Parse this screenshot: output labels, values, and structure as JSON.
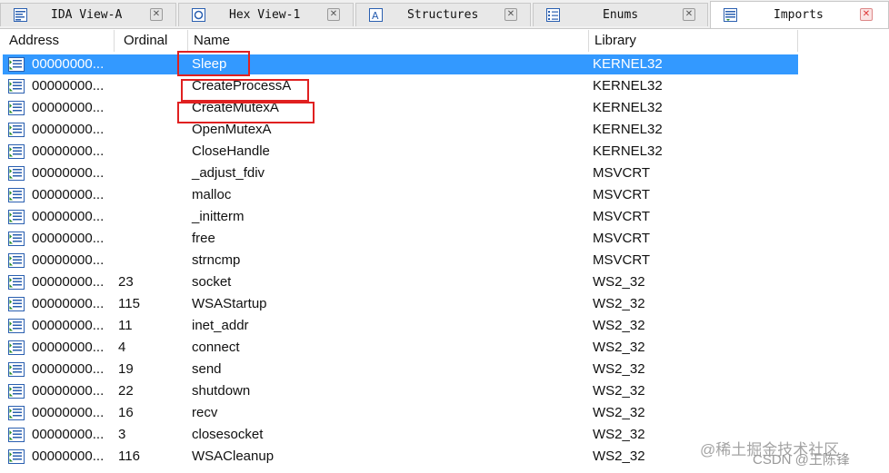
{
  "tabs": [
    {
      "label": "IDA View-A",
      "icon": "ida-view-icon"
    },
    {
      "label": "Hex View-1",
      "icon": "hex-view-icon"
    },
    {
      "label": "Structures",
      "icon": "structures-icon"
    },
    {
      "label": "Enums",
      "icon": "enums-icon"
    },
    {
      "label": "Imports",
      "icon": "imports-icon",
      "active": true
    }
  ],
  "close_glyph": "✕",
  "columns": [
    "Address",
    "Ordinal",
    "Name",
    "Library"
  ],
  "rows": [
    {
      "address": "00000000...",
      "ordinal": "",
      "name": "Sleep",
      "library": "KERNEL32",
      "selected": true,
      "highlighted": true
    },
    {
      "address": "00000000...",
      "ordinal": "",
      "name": "CreateProcessA",
      "library": "KERNEL32",
      "highlighted": true
    },
    {
      "address": "00000000...",
      "ordinal": "",
      "name": "CreateMutexA",
      "library": "KERNEL32",
      "highlighted": true
    },
    {
      "address": "00000000...",
      "ordinal": "",
      "name": "OpenMutexA",
      "library": "KERNEL32"
    },
    {
      "address": "00000000...",
      "ordinal": "",
      "name": "CloseHandle",
      "library": "KERNEL32"
    },
    {
      "address": "00000000...",
      "ordinal": "",
      "name": "_adjust_fdiv",
      "library": "MSVCRT"
    },
    {
      "address": "00000000...",
      "ordinal": "",
      "name": "malloc",
      "library": "MSVCRT"
    },
    {
      "address": "00000000...",
      "ordinal": "",
      "name": "_initterm",
      "library": "MSVCRT"
    },
    {
      "address": "00000000...",
      "ordinal": "",
      "name": "free",
      "library": "MSVCRT"
    },
    {
      "address": "00000000...",
      "ordinal": "",
      "name": "strncmp",
      "library": "MSVCRT"
    },
    {
      "address": "00000000...",
      "ordinal": "23",
      "name": "socket",
      "library": "WS2_32"
    },
    {
      "address": "00000000...",
      "ordinal": "115",
      "name": "WSAStartup",
      "library": "WS2_32"
    },
    {
      "address": "00000000...",
      "ordinal": "11",
      "name": "inet_addr",
      "library": "WS2_32"
    },
    {
      "address": "00000000...",
      "ordinal": "4",
      "name": "connect",
      "library": "WS2_32"
    },
    {
      "address": "00000000...",
      "ordinal": "19",
      "name": "send",
      "library": "WS2_32"
    },
    {
      "address": "00000000...",
      "ordinal": "22",
      "name": "shutdown",
      "library": "WS2_32"
    },
    {
      "address": "00000000...",
      "ordinal": "16",
      "name": "recv",
      "library": "WS2_32"
    },
    {
      "address": "00000000...",
      "ordinal": "3",
      "name": "closesocket",
      "library": "WS2_32"
    },
    {
      "address": "00000000...",
      "ordinal": "116",
      "name": "WSACleanup",
      "library": "WS2_32"
    }
  ],
  "row_icon": "import-entry-icon",
  "colors": {
    "selection": "#3399ff",
    "highlight_box": "#e02020"
  },
  "watermark": {
    "line1": "@稀土掘金技术社区",
    "line2": "CSDN @王陈锋"
  }
}
